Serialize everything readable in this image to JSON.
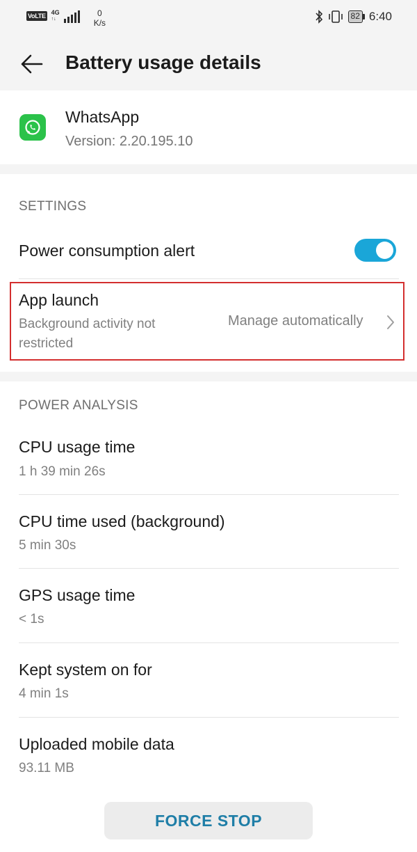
{
  "status_bar": {
    "volte": "VoLTE",
    "network_type": "4G",
    "network_sub": "↑↓",
    "speed_value": "0",
    "speed_unit": "K/s",
    "battery_level": "82",
    "time": "6:40"
  },
  "app_bar": {
    "title": "Battery usage details"
  },
  "app_info": {
    "name": "WhatsApp",
    "version": "Version: 2.20.195.10"
  },
  "settings": {
    "header": "SETTINGS",
    "power_alert_label": "Power consumption alert",
    "power_alert_enabled": true,
    "app_launch": {
      "title": "App launch",
      "subtitle_line1": "Background activity not",
      "subtitle_line2": "restricted",
      "value": "Manage automatically"
    }
  },
  "power_analysis": {
    "header": "POWER ANALYSIS",
    "items": [
      {
        "label": "CPU usage time",
        "value": "1 h 39 min 26s"
      },
      {
        "label": "CPU time used (background)",
        "value": "5 min 30s"
      },
      {
        "label": "GPS usage time",
        "value": "< 1s"
      },
      {
        "label": "Kept system on for",
        "value": "4 min 1s"
      },
      {
        "label": "Uploaded mobile data",
        "value": "93.11 MB"
      }
    ]
  },
  "actions": {
    "force_stop": "FORCE STOP"
  },
  "colors": {
    "accent": "#1aa6d8",
    "force_stop_text": "#1f7ea7",
    "highlight_border": "#d32f2f",
    "whatsapp_green": "#2bc24a"
  }
}
